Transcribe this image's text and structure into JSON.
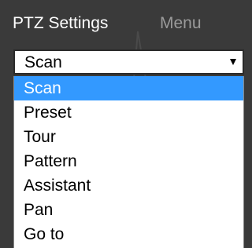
{
  "tabs": {
    "active_label": "PTZ Settings",
    "inactive_label": "Menu"
  },
  "mode_select": {
    "value": "Scan",
    "options": [
      "Scan",
      "Preset",
      "Tour",
      "Pattern",
      "Assistant",
      "Pan",
      "Go to"
    ],
    "highlighted_option": "Scan"
  },
  "colors": {
    "background": "#3a3a3a",
    "highlight": "#3399ff",
    "active_tab_text": "#ffffff",
    "inactive_tab_text": "#9a9a9a"
  }
}
